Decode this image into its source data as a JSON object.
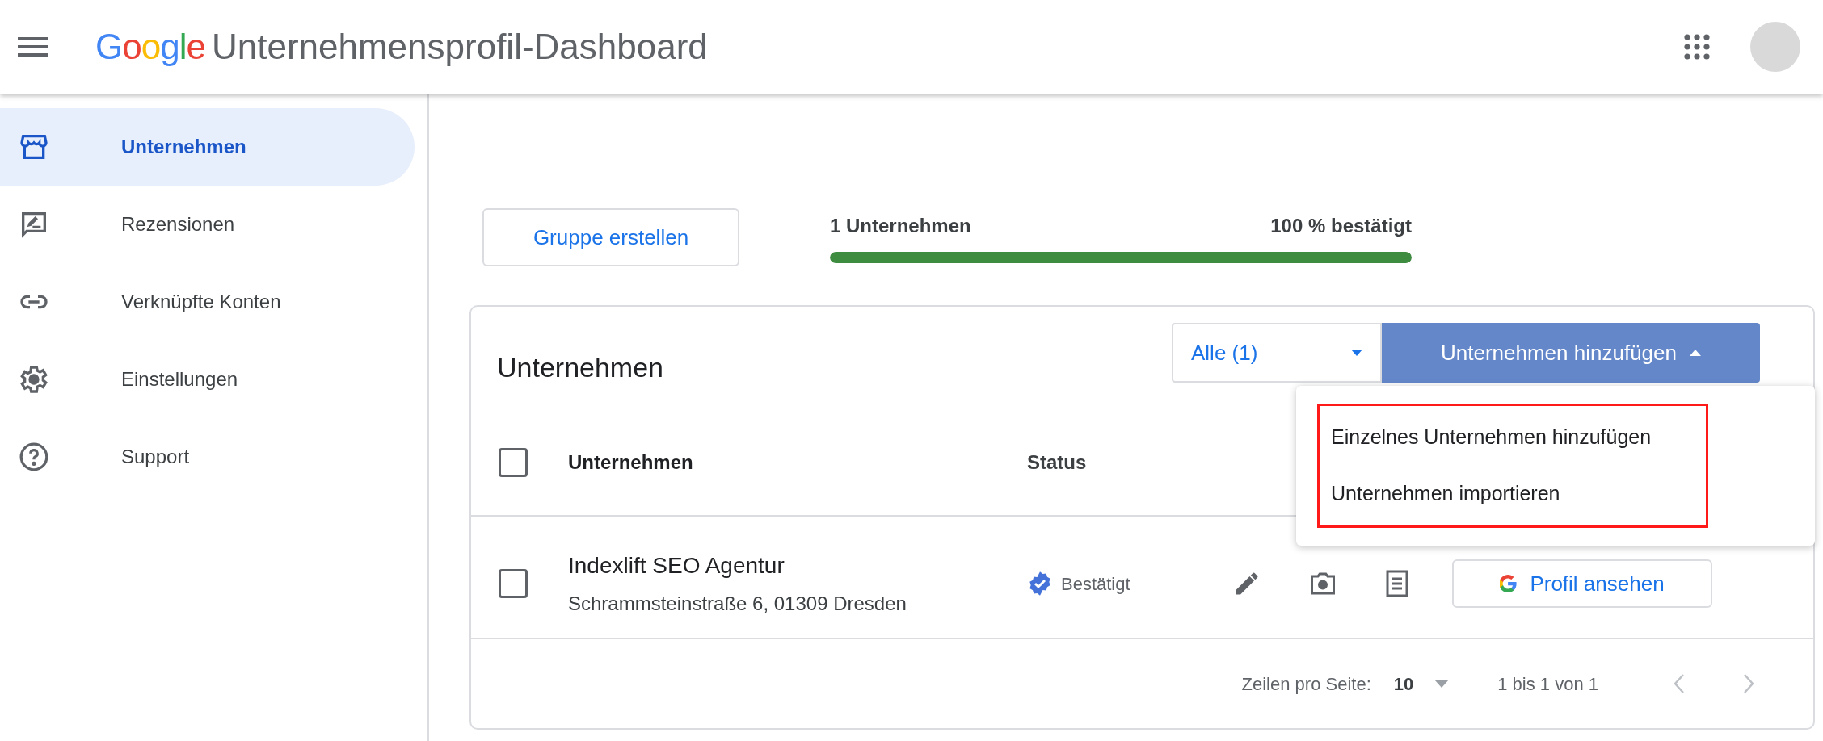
{
  "header": {
    "logo": "Google",
    "title": "Unternehmensprofil-Dashboard"
  },
  "sidebar": {
    "items": [
      {
        "kind": "store",
        "label": "Unternehmen",
        "selected": true
      },
      {
        "kind": "review",
        "label": "Rezensionen",
        "selected": false
      },
      {
        "kind": "link",
        "label": "Verknüpfte Konten",
        "selected": false
      },
      {
        "kind": "settings",
        "label": "Einstellungen",
        "selected": false
      },
      {
        "kind": "help",
        "label": "Support",
        "selected": false
      }
    ]
  },
  "group_button": "Gruppe erstellen",
  "summary": {
    "count": "1 Unternehmen",
    "verified": "100 % bestätigt",
    "level": 1
  },
  "card": {
    "title": "Unternehmen",
    "filter": {
      "value": "Alle (1)"
    },
    "add_button": {
      "label": "Unternehmen hinzufügen",
      "expanded": true
    },
    "menu": {
      "highlighted": true,
      "items": [
        {
          "label": "Einzelnes Unternehmen hinzufügen"
        },
        {
          "label": "Unternehmen importieren"
        }
      ]
    },
    "table": {
      "select_all": {
        "checked": false
      },
      "columns": [
        "Unternehmen",
        "Status"
      ],
      "rows": [
        {
          "checked": false,
          "name": "Indexlift SEO Agentur",
          "address": "Schrammsteinstraße 6, 01309 Dresden",
          "status": "Bestätigt",
          "verified": true,
          "action": "Profil ansehen"
        }
      ]
    },
    "footer": {
      "rows_label": "Zeilen pro Seite:",
      "rows_value": "10",
      "range": "1 bis 1 von 1"
    }
  }
}
